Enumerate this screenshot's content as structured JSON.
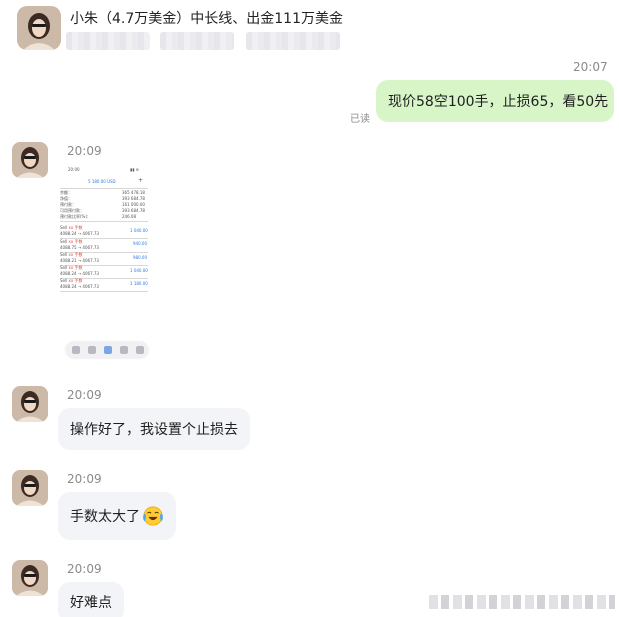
{
  "header": {
    "title": "小朱（4.7万美金）中长线、出金111万美金"
  },
  "messages": {
    "m1": {
      "time": "20:07",
      "text": "现价58空100手，止损65，看50先",
      "status": "已读"
    },
    "m2": {
      "time": "20:09"
    },
    "m3": {
      "time": "20:09",
      "text": "操作好了，我设置个止损去"
    },
    "m4": {
      "time": "20:09",
      "text": "手数太大了"
    },
    "m5": {
      "time": "20:09",
      "text": "好难点"
    }
  },
  "screenshot": {
    "clock": "20:00",
    "balance": "5 180.00 USD",
    "rows": [
      {
        "label": "余额：",
        "value": "365 478.18"
      },
      {
        "label": "净值：",
        "value": "393 684.78"
      },
      {
        "label": "预付款：",
        "value": "161 000.00"
      },
      {
        "label": "可用预付款：",
        "value": "393 684.78"
      },
      {
        "label": "预付款比率(%)：",
        "value": "246.08"
      }
    ],
    "orders": [
      {
        "side": "Sell",
        "qty": "xx 手数",
        "prices": "4088.24 → 4067.73",
        "profit": "1 040.00"
      },
      {
        "side": "Sell",
        "qty": "xx 手数",
        "prices": "4088.75 → 4067.73",
        "profit": "940.00"
      },
      {
        "side": "Sell",
        "qty": "xx 手数",
        "prices": "4088.21 → 4067.73",
        "profit": "980.00"
      },
      {
        "side": "Sell",
        "qty": "xx 手数",
        "prices": "4088.24 → 4067.73",
        "profit": "1 040.00"
      },
      {
        "side": "Sell",
        "qty": "xx 手数",
        "prices": "4088.24 → 4067.73",
        "profit": "1 180.00"
      }
    ]
  },
  "colors": {
    "my_bubble": "#d8f5c8",
    "other_bubble": "#f3f4f7",
    "profit_blue": "#2a7de1"
  },
  "icons": [
    "avatar-photo",
    "crying-laughing-emoji"
  ]
}
